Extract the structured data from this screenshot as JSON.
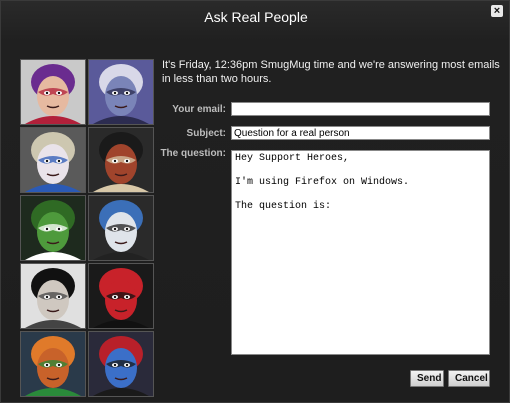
{
  "dialog": {
    "title": "Ask Real People",
    "close_glyph": "×",
    "intro": "It's Friday, 12:36pm SmugMug time and we're answering most emails in less than two hours."
  },
  "form": {
    "email_label": "Your email:",
    "email_value": "",
    "subject_label": "Subject:",
    "subject_value": "Question for a real person",
    "question_label": "The question:",
    "question_value": "Hey Support Heroes,\n\nI'm using Firefox on Windows.\n\nThe question is:"
  },
  "buttons": {
    "send": "Send",
    "cancel": "Cancel"
  },
  "portraits": [
    {
      "name": "purple-hair-face-portrait",
      "bg": "#c9c9c9",
      "skin": "#e6b9a0",
      "hair": "#6a2c8f",
      "accent": "#b2203a"
    },
    {
      "name": "blue-painted-face-portrait",
      "bg": "#5a5a9a",
      "skin": "#7a84b8",
      "hair": "#d8d8e8",
      "accent": "#2c2c50"
    },
    {
      "name": "white-mask-face-portrait",
      "bg": "#5a5a5a",
      "skin": "#e9e3ea",
      "hair": "#cdc7b0",
      "accent": "#2b5ab5"
    },
    {
      "name": "red-skull-face-portrait",
      "bg": "#2a2a2a",
      "skin": "#a0442c",
      "hair": "#1a1a1a",
      "accent": "#d8c8a8"
    },
    {
      "name": "green-goblin-face-portrait",
      "bg": "#1e2a1e",
      "skin": "#4e9a3c",
      "hair": "#2f6a24",
      "accent": "#ffffff"
    },
    {
      "name": "blue-white-mask-portrait",
      "bg": "#2a2a2a",
      "skin": "#dfe4ea",
      "hair": "#3b6fb8",
      "accent": "#222222"
    },
    {
      "name": "black-hat-mask-portrait",
      "bg": "#e0e0e0",
      "skin": "#cfc8c0",
      "hair": "#111111",
      "accent": "#444444"
    },
    {
      "name": "spider-face-portrait",
      "bg": "#1a1a1a",
      "skin": "#c8222a",
      "hair": "#c8222a",
      "accent": "#111111"
    },
    {
      "name": "orange-helmet-face-portrait",
      "bg": "#2a3a4a",
      "skin": "#c8622a",
      "hair": "#e07a2a",
      "accent": "#2a8a3a"
    },
    {
      "name": "blue-skin-face-portrait",
      "bg": "#2a2a3a",
      "skin": "#3b6fc8",
      "hair": "#b8202a",
      "accent": "#1a1a1a"
    }
  ]
}
